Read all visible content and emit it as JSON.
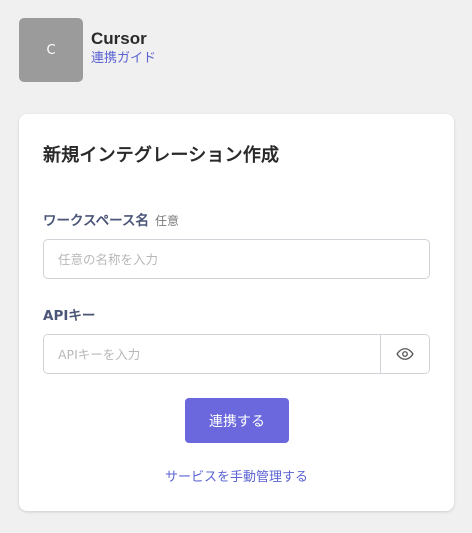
{
  "app": {
    "logo_letter": "C",
    "name": "Cursor",
    "guide_link": "連携ガイド"
  },
  "form": {
    "title": "新規インテグレーション作成",
    "workspace": {
      "label": "ワークスペース名",
      "optional": "任意",
      "placeholder": "任意の名称を入力",
      "value": ""
    },
    "api_key": {
      "label": "APIキー",
      "placeholder": "APIキーを入力",
      "value": ""
    },
    "submit_label": "連携する",
    "manual_link": "サービスを手動管理する"
  },
  "icons": {
    "show_password": "eye-icon"
  },
  "colors": {
    "accent": "#6a68dc",
    "link": "#5b63d3",
    "logo_bg": "#9b9b9b",
    "page_bg": "#f0f0f1"
  }
}
